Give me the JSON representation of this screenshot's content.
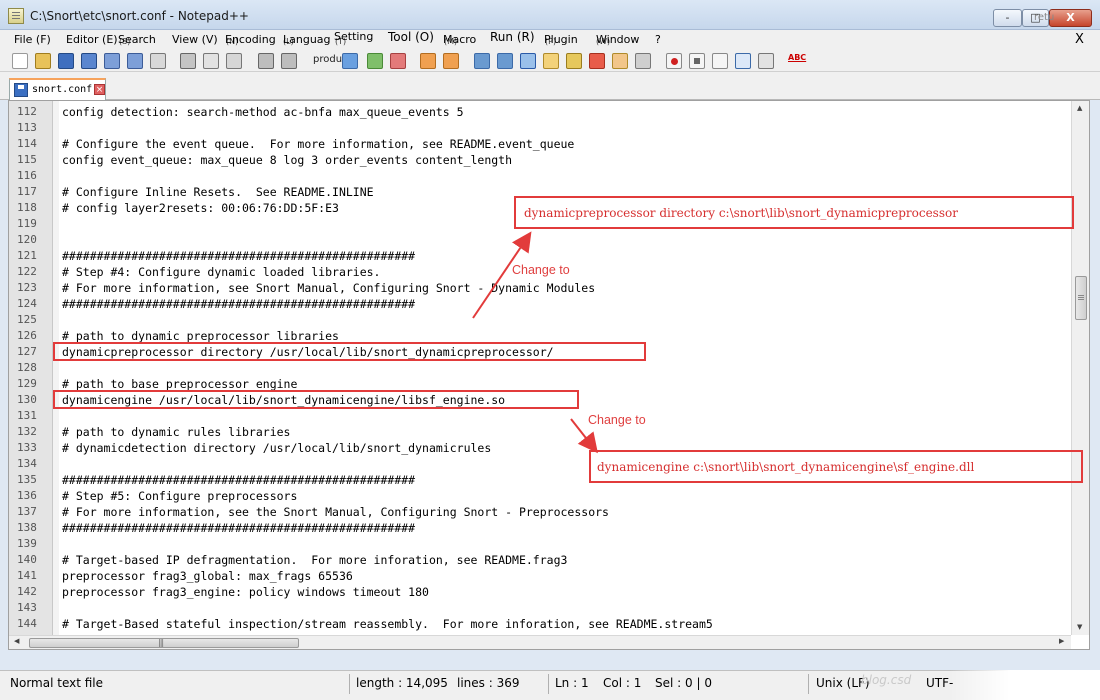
{
  "window": {
    "title": "C:\\Snort\\etc\\snort.conf - Notepad++",
    "minimize_label": "-",
    "maximize_label": "□",
    "close_label": "X",
    "restore_hint": "retu"
  },
  "menu": {
    "items": [
      "File (F)",
      "Editor (E)",
      "Search",
      "View (V)",
      "Encoding",
      "Languag",
      "Setting",
      "Tool (O)",
      "Macro",
      "Run (R)",
      "Plugin",
      "Window",
      "?"
    ],
    "subs": [
      "(S)",
      "(N)",
      "(L)",
      "(T)",
      "(M)",
      "(P)",
      "(W)"
    ],
    "close_doc": "X"
  },
  "toolbar": {
    "product_label": "product",
    "icons": [
      "new-file-icon",
      "open-file-icon",
      "save-icon",
      "save-all-icon",
      "close-icon",
      "close-all-icon",
      "print-icon",
      "cut-icon",
      "copy-icon",
      "paste-icon",
      "undo-icon",
      "redo-icon",
      "find-icon",
      "replace-icon",
      "zoom-in-icon",
      "zoom-out-icon",
      "sync-v-icon",
      "sync-h-icon",
      "word-wrap-icon",
      "show-all-chars-icon",
      "indent-guide-icon",
      "user-lang-icon",
      "doc-map-icon",
      "function-list-icon",
      "folder-workspace-icon",
      "monitor-icon",
      "record-macro-icon",
      "stop-record-icon",
      "play-macro-icon",
      "run-macro-multiple-icon",
      "save-macro-icon",
      "spell-check-icon"
    ],
    "spell_label": "ABC"
  },
  "tab": {
    "label": "snort.conf"
  },
  "editor": {
    "lines": [
      {
        "n": "112",
        "text": "config detection: search-method ac-bnfa max_queue_events 5"
      },
      {
        "n": "113",
        "text": ""
      },
      {
        "n": "114",
        "text": "# Configure the event queue.  For more information, see README.event_queue"
      },
      {
        "n": "115",
        "text": "config event_queue: max_queue 8 log 3 order_events content_length"
      },
      {
        "n": "116",
        "text": ""
      },
      {
        "n": "117",
        "text": "# Configure Inline Resets.  See README.INLINE"
      },
      {
        "n": "118",
        "text": "# config layer2resets: 00:06:76:DD:5F:E3"
      },
      {
        "n": "119",
        "text": ""
      },
      {
        "n": "120",
        "text": ""
      },
      {
        "n": "121",
        "text": "###################################################"
      },
      {
        "n": "122",
        "text": "# Step #4: Configure dynamic loaded libraries."
      },
      {
        "n": "123",
        "text": "# For more information, see Snort Manual, Configuring Snort - Dynamic Modules"
      },
      {
        "n": "124",
        "text": "###################################################"
      },
      {
        "n": "125",
        "text": ""
      },
      {
        "n": "126",
        "text": "# path to dynamic preprocessor libraries"
      },
      {
        "n": "127",
        "text": "dynamicpreprocessor directory /usr/local/lib/snort_dynamicpreprocessor/"
      },
      {
        "n": "128",
        "text": ""
      },
      {
        "n": "129",
        "text": "# path to base preprocessor engine"
      },
      {
        "n": "130",
        "text": "dynamicengine /usr/local/lib/snort_dynamicengine/libsf_engine.so"
      },
      {
        "n": "131",
        "text": ""
      },
      {
        "n": "132",
        "text": "# path to dynamic rules libraries"
      },
      {
        "n": "133",
        "text": "# dynamicdetection directory /usr/local/lib/snort_dynamicrules"
      },
      {
        "n": "134",
        "text": ""
      },
      {
        "n": "135",
        "text": "###################################################"
      },
      {
        "n": "136",
        "text": "# Step #5: Configure preprocessors"
      },
      {
        "n": "137",
        "text": "# For more information, see the Snort Manual, Configuring Snort - Preprocessors"
      },
      {
        "n": "138",
        "text": "###################################################"
      },
      {
        "n": "139",
        "text": ""
      },
      {
        "n": "140",
        "text": "# Target-based IP defragmentation.  For more inforation, see README.frag3"
      },
      {
        "n": "141",
        "text": "preprocessor frag3_global: max_frags 65536"
      },
      {
        "n": "142",
        "text": "preprocessor frag3_engine: policy windows timeout 180"
      },
      {
        "n": "143",
        "text": ""
      },
      {
        "n": "144",
        "text": "# Target-Based stateful inspection/stream reassembly.  For more inforation, see README.stream5"
      },
      {
        "n": "145",
        "text": "preprocessor stream5_global: max_tcp 8192, track_tcp yes, track_udp no"
      }
    ]
  },
  "annotations": {
    "preproc_replacement": "dynamicpreprocessor directory c:\\snort\\lib\\snort_dynamicpreprocessor",
    "engine_replacement": "dynamicengine c:\\snort\\lib\\snort_dynamicengine\\sf_engine.dll",
    "change_label_1": "Change to",
    "change_label_2": "Change to",
    "color": "#e23b3b"
  },
  "hscroll": {
    "grip": "|||"
  },
  "status": {
    "file_type": "Normal text file",
    "length": "length : 14,095",
    "lines": "lines : 369",
    "ln": "Ln : 1",
    "col": "Col : 1",
    "sel": "Sel : 0 | 0",
    "eol": "Unix (LF)",
    "encoding": "UTF-",
    "watermark": "blog.csd"
  }
}
